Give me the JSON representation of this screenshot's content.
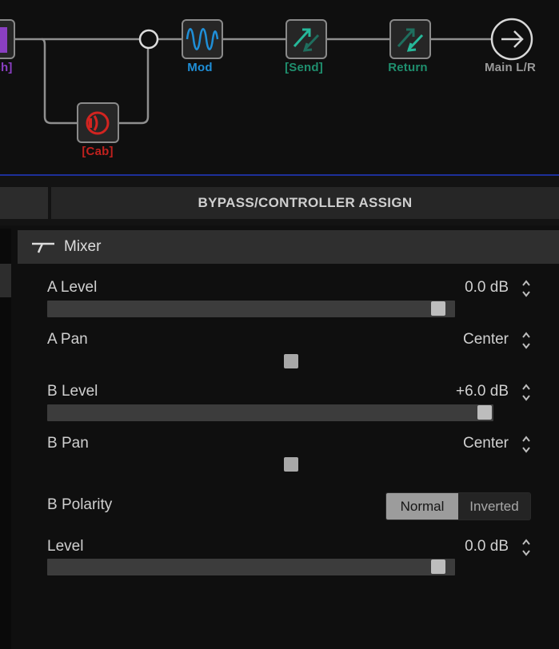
{
  "signal_chain": {
    "blocks": [
      {
        "id": "switch",
        "label": "ch]",
        "color": "#8a3fc2"
      },
      {
        "id": "cab",
        "label": "[Cab]",
        "color": "#c0211e"
      },
      {
        "id": "mod",
        "label": "Mod",
        "color": "#1f8fd8"
      },
      {
        "id": "send",
        "label": "[Send]",
        "color": "#1f8f6e"
      },
      {
        "id": "return",
        "label": "Return",
        "color": "#1f8f6e"
      },
      {
        "id": "output",
        "label": "Main L/R",
        "color": "#9a9a9a"
      }
    ]
  },
  "tabs": {
    "bypass": "BYPASS/CONTROLLER ASSIGN"
  },
  "mixer": {
    "title": "Mixer",
    "params": {
      "a_level": {
        "label": "A Level",
        "value": "0.0 dB",
        "position": 0.98
      },
      "a_pan": {
        "label": "A Pan",
        "value": "Center",
        "position": 0.5
      },
      "b_level": {
        "label": "B Level",
        "value": "+6.0 dB",
        "position": 1.0
      },
      "b_pan": {
        "label": "B Pan",
        "value": "Center",
        "position": 0.5
      },
      "b_polarity": {
        "label": "B Polarity",
        "options": [
          "Normal",
          "Inverted"
        ],
        "selected": "Normal"
      },
      "level": {
        "label": "Level",
        "value": "0.0 dB",
        "position": 0.98
      }
    }
  },
  "colors": {
    "accent_blue": "#1d2f9a",
    "mod": "#1f8fd8",
    "cab": "#c0211e",
    "fx_loop": "#1f8f6e"
  },
  "icons": [
    "switch-block-icon",
    "mod-wave-icon",
    "cab-speaker-icon",
    "send-icon",
    "return-icon",
    "output-arrow-icon",
    "mixer-icon",
    "chevron-up-down-icon"
  ]
}
